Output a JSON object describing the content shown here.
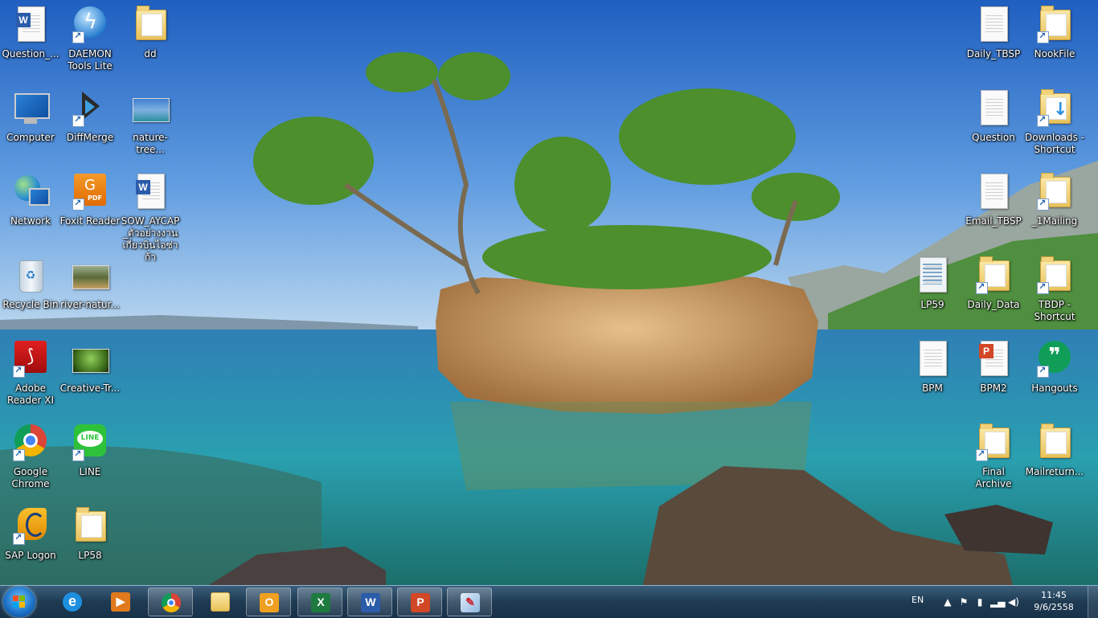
{
  "desktop": {
    "left_icons": [
      {
        "label": "Question_...",
        "icon": "word-doc-icon",
        "kind": "worddoc",
        "shortcut": false
      },
      {
        "label": "DAEMON Tools Lite",
        "icon": "daemon-tools-icon",
        "kind": "daemon",
        "shortcut": true
      },
      {
        "label": "dd",
        "icon": "folder-icon",
        "kind": "folder",
        "shortcut": false
      },
      {
        "label": "Computer",
        "icon": "computer-icon",
        "kind": "computer",
        "shortcut": false
      },
      {
        "label": "DiffMerge",
        "icon": "diffmerge-icon",
        "kind": "diffmerge",
        "shortcut": true
      },
      {
        "label": "nature-tree...",
        "icon": "image-file-icon",
        "kind": "thumb1",
        "shortcut": false
      },
      {
        "label": "Network",
        "icon": "network-icon",
        "kind": "network",
        "shortcut": false
      },
      {
        "label": "Foxit Reader",
        "icon": "foxit-reader-icon",
        "kind": "foxit",
        "shortcut": true
      },
      {
        "label": "SOW_AYCAP_ตัวอย่างงานเกี่ยวบินไอซ่าก้า",
        "icon": "word-doc-icon",
        "kind": "worddoc",
        "shortcut": false
      },
      {
        "label": "Recycle Bin",
        "icon": "recycle-bin-icon",
        "kind": "recycle",
        "shortcut": false
      },
      {
        "label": "river-natur...",
        "icon": "image-file-icon",
        "kind": "thumb2",
        "shortcut": false
      },
      {
        "label": "Adobe Reader XI",
        "icon": "adobe-reader-icon",
        "kind": "adobe",
        "shortcut": true
      },
      {
        "label": "Creative-Tr...",
        "icon": "image-file-icon",
        "kind": "thumb3",
        "shortcut": false
      },
      {
        "label": "Google Chrome",
        "icon": "chrome-icon",
        "kind": "chrome",
        "shortcut": true
      },
      {
        "label": "LINE",
        "icon": "line-icon",
        "kind": "line",
        "shortcut": true
      },
      {
        "label": "SAP Logon",
        "icon": "sap-logon-icon",
        "kind": "sap",
        "shortcut": true
      },
      {
        "label": "LP58",
        "icon": "folder-icon",
        "kind": "folder",
        "shortcut": false
      }
    ],
    "right_icons": [
      {
        "label": "Daily_TBSP",
        "icon": "text-file-icon",
        "kind": "textdoc",
        "shortcut": false
      },
      {
        "label": "NookFile",
        "icon": "folder-icon",
        "kind": "folder",
        "shortcut": true
      },
      {
        "label": "Question",
        "icon": "text-file-icon",
        "kind": "textdoc",
        "shortcut": false
      },
      {
        "label": "Downloads - Shortcut",
        "icon": "downloads-folder-icon",
        "kind": "folder",
        "shortcut": true
      },
      {
        "label": "Email_TBSP",
        "icon": "text-file-icon",
        "kind": "textdoc",
        "shortcut": false
      },
      {
        "label": "_1Mailing",
        "icon": "folder-icon",
        "kind": "folder",
        "shortcut": true
      },
      {
        "label": "LP59",
        "icon": "text-file-icon",
        "kind": "textdoc",
        "shortcut": false
      },
      {
        "label": "Daily_Data",
        "icon": "folder-icon",
        "kind": "folder",
        "shortcut": true
      },
      {
        "label": "TBDP - Shortcut",
        "icon": "folder-icon",
        "kind": "folder",
        "shortcut": true
      },
      {
        "label": "BPM",
        "icon": "text-file-icon",
        "kind": "textdoc",
        "shortcut": false
      },
      {
        "label": "BPM2",
        "icon": "powerpoint-file-icon",
        "kind": "pptdoc",
        "shortcut": false
      },
      {
        "label": "Hangouts",
        "icon": "hangouts-icon",
        "kind": "hangouts",
        "shortcut": true
      },
      {
        "label": "Final Archive",
        "icon": "folder-icon",
        "kind": "folder",
        "shortcut": true
      },
      {
        "label": "Mailreturn...",
        "icon": "folder-icon",
        "kind": "folder",
        "shortcut": false
      }
    ]
  },
  "taskbar": {
    "start_icon": "windows-start-icon",
    "buttons": [
      {
        "name": "internet-explorer",
        "icon": "ie-icon",
        "color": "#1d8fe0",
        "glyph": "e",
        "open": false
      },
      {
        "name": "media-player",
        "icon": "media-player-icon",
        "color": "#e07a1d",
        "glyph": "▶",
        "open": false
      },
      {
        "name": "chrome",
        "icon": "chrome-icon",
        "color": "#dd4433",
        "glyph": "◉",
        "open": true
      },
      {
        "name": "file-explorer",
        "icon": "folder-icon",
        "color": "#e8c25a",
        "glyph": "▤",
        "open": false
      },
      {
        "name": "outlook",
        "icon": "outlook-icon",
        "color": "#f0a020",
        "glyph": "O",
        "open": true
      },
      {
        "name": "excel",
        "icon": "excel-icon",
        "color": "#1f7a3f",
        "glyph": "X",
        "open": true
      },
      {
        "name": "word",
        "icon": "word-icon",
        "color": "#2a5caa",
        "glyph": "W",
        "open": true
      },
      {
        "name": "powerpoint",
        "icon": "powerpoint-icon",
        "color": "#d24726",
        "glyph": "P",
        "open": true
      },
      {
        "name": "paint",
        "icon": "paint-icon",
        "color": "#8fb8e0",
        "glyph": "✎",
        "open": true
      }
    ],
    "tray": {
      "language": "EN",
      "time": "11:45",
      "date": "9/6/2558"
    }
  }
}
